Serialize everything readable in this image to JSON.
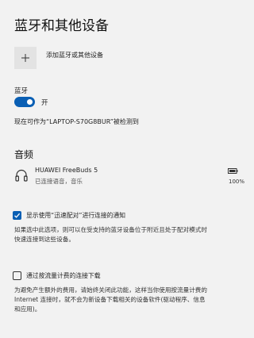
{
  "header": {
    "title": "蓝牙和其他设备"
  },
  "add_device": {
    "label": "添加蓝牙或其他设备"
  },
  "bluetooth": {
    "section_label": "蓝牙",
    "toggle_state_label": "开",
    "discoverable_text": "现在可作为“LAPTOP-S70G8BUR”被检测到"
  },
  "audio": {
    "heading": "音频",
    "devices": [
      {
        "name": "HUAWEI FreeBuds 5",
        "status": "已连接语音，音乐",
        "battery": "100%",
        "icon": "headphones-icon"
      }
    ]
  },
  "swift_pair": {
    "checked": true,
    "label": "显示使用“迅速配对”进行连接的通知",
    "description_lines": [
      "如果选中此选项，则可以在受支持的蓝牙设备位于附近且处于配对模式时",
      "快速连接到这些设备。"
    ]
  },
  "metered": {
    "checked": false,
    "label": "通过按流量计费的连接下载",
    "description_lines": [
      "为避免产生额外的费用，请始终关闭此功能，这样当你使用按流量计费的",
      "Internet 连接时，就不会为新设备下载相关的设备软件(驱动程序、信息",
      "和应用)。"
    ]
  },
  "colors": {
    "accent": "#0a5fb4",
    "background": "#f2f2f2"
  }
}
